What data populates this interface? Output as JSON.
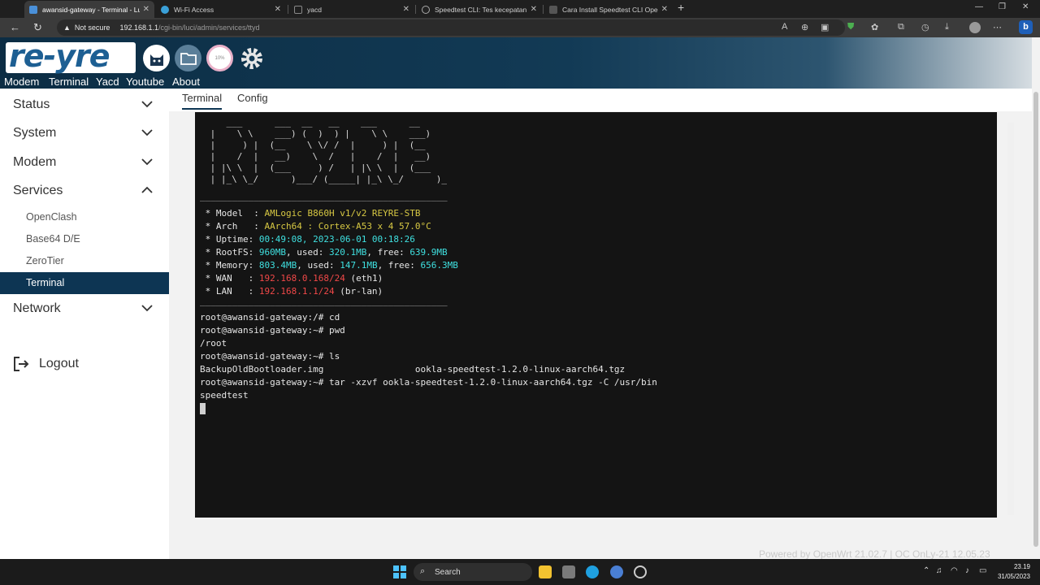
{
  "browser": {
    "tabs": [
      {
        "title": "awansid-gateway - Terminal - Lu",
        "active": true
      },
      {
        "title": "Wi-Fi Access",
        "active": false
      },
      {
        "title": "yacd",
        "active": false
      },
      {
        "title": "Speedtest CLI: Tes kecepatan int",
        "active": false
      },
      {
        "title": "Cara Install Speedtest CLI Openw",
        "active": false
      }
    ],
    "close_glyph": "✕",
    "new_tab_glyph": "+",
    "window_controls": [
      "—",
      "❐",
      "✕"
    ],
    "security_label": "Not secure",
    "url_host": "192.168.1.1",
    "url_path": "/cgi-bin/luci/admin/services/ttyd"
  },
  "header": {
    "logo_text": "re-yre",
    "menu": [
      "Modem",
      "Terminal",
      "Yacd",
      "Youtube",
      "About"
    ],
    "icons": [
      "cat-icon",
      "folder-icon",
      "gauge-icon",
      "gear-icon"
    ],
    "gauge_value": "10%"
  },
  "sidebar": {
    "sections": [
      {
        "label": "Status",
        "expanded": false
      },
      {
        "label": "System",
        "expanded": false
      },
      {
        "label": "Modem",
        "expanded": false
      },
      {
        "label": "Services",
        "expanded": true
      },
      {
        "label": "Network",
        "expanded": false
      }
    ],
    "services_items": [
      {
        "label": "OpenClash",
        "active": false
      },
      {
        "label": "Base64 D/E",
        "active": false
      },
      {
        "label": "ZeroTier",
        "active": false
      },
      {
        "label": "Terminal",
        "active": true
      }
    ],
    "logout_label": "Logout"
  },
  "content": {
    "tabs": [
      {
        "label": "Terminal",
        "active": true
      },
      {
        "label": "Config",
        "active": false
      }
    ],
    "footer": "Powered by OpenWrt 21.02.7 | OC OnLy-21 12.05.23"
  },
  "terminal": {
    "banner": "    ___      ___  __   __    ___      __\n |    \\ \\    ___) (  )  ) |    \\ \\    ___)\n |     ) |  (__    \\ \\/ /  |     ) |  (__\n |    /  |   __)    \\  /   |    /  |   __)\n | |\\ \\  |  (___     ) /   | |\\ \\  |  (___\n | |_\\ \\_/      )___/ (_____| |_\\ \\_/      )_",
    "separator": "______________________________________________",
    "sysinfo": {
      "model_label": " * Model  : ",
      "model_value": "AMLogic B860H v1/v2 REYRE-STB",
      "arch_label": " * Arch   : ",
      "arch_value": "AArch64 : Cortex-A53 x 4 57.0°C",
      "uptime_label": " * Uptime: ",
      "uptime_value": "00:49:08, 2023-06-01 00:18:26",
      "rootfs_label": " * RootFS: ",
      "rootfs_total": "960MB",
      "rootfs_used_label": ", used: ",
      "rootfs_used": "320.1MB",
      "rootfs_free_label": ", free: ",
      "rootfs_free": "639.9MB",
      "memory_label": " * Memory: ",
      "memory_total": "803.4MB",
      "memory_used_label": ", used: ",
      "memory_used": "147.1MB",
      "memory_free_label": ", free: ",
      "memory_free": "656.3MB",
      "wan_label": " * WAN   : ",
      "wan_ip": "192.168.0.168/24",
      "wan_if": " (eth1)",
      "lan_label": " * LAN   : ",
      "lan_ip": "192.168.1.1/24",
      "lan_if": " (br-lan)"
    },
    "lines": [
      "root@awansid-gateway:/# cd",
      "root@awansid-gateway:~# pwd",
      "/root",
      "root@awansid-gateway:~# ls",
      "BackupOldBootloader.img                 ookla-speedtest-1.2.0-linux-aarch64.tgz",
      "root@awansid-gateway:~# tar -xzvf ookla-speedtest-1.2.0-linux-aarch64.tgz -C /usr/bin",
      "speedtest"
    ]
  },
  "taskbar": {
    "search_placeholder": "Search",
    "time": "23.19",
    "date": "31/05/2023"
  },
  "colors": {
    "header_dark": "#0c2d44",
    "sidebar_active": "#0d3553",
    "term_bg": "#141414",
    "term_yellow": "#d7c843",
    "term_cyan": "#3fe0e0",
    "term_red": "#f04848"
  }
}
